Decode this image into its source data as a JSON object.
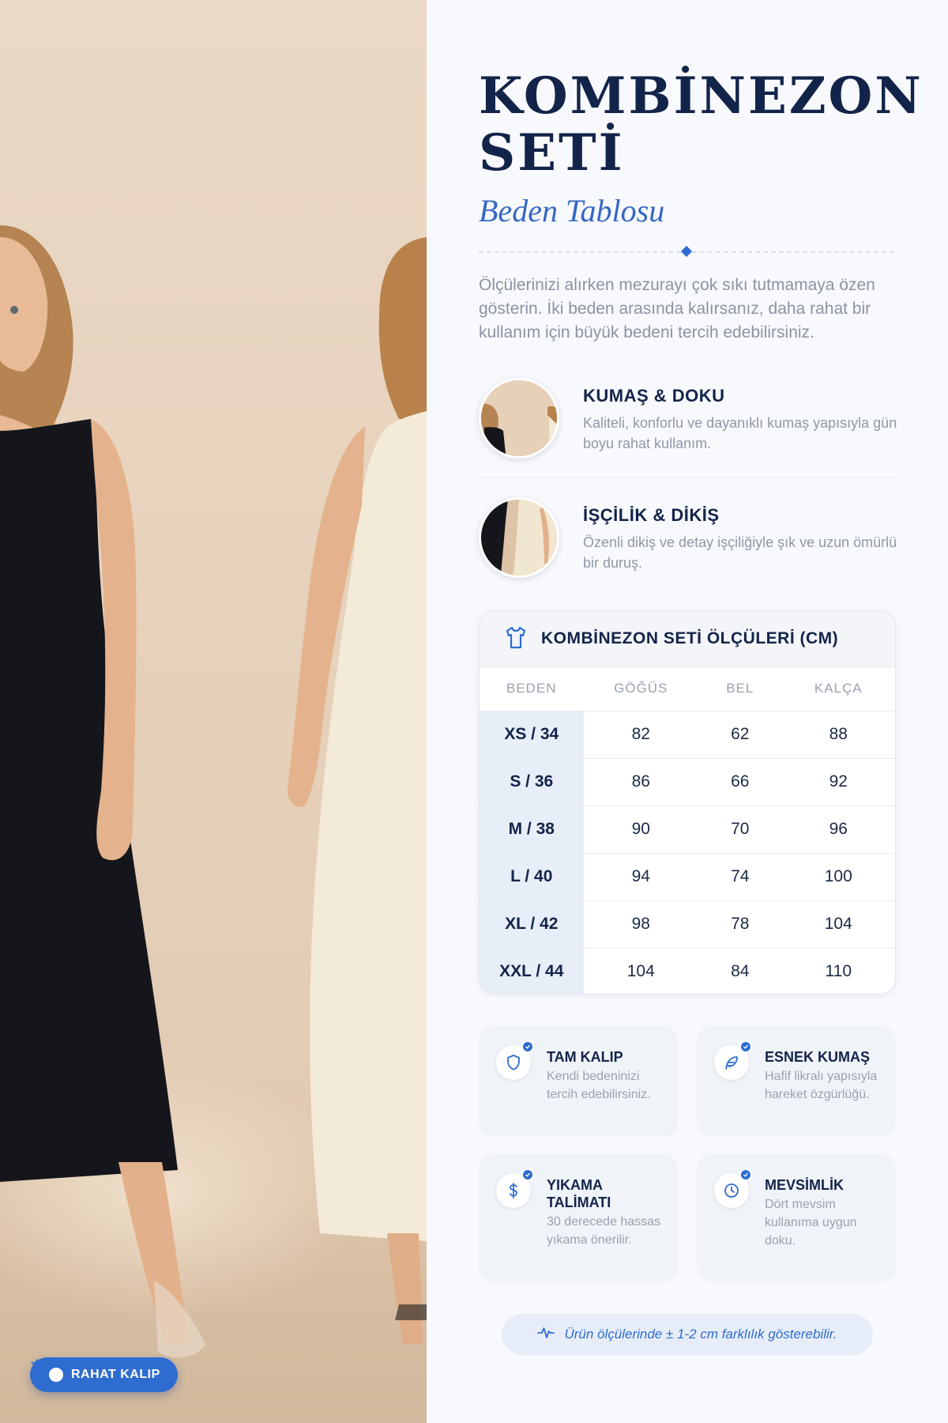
{
  "product": {
    "title": "KOMBİNEZON SETİ",
    "subtitle": "Beden Tablosu",
    "intro": "Ölçülerinizi alırken mezurayı çok sıkı tutmamaya özen gösterin. İki beden arasında kalırsanız, daha rahat bir kullanım için büyük bedeni tercih edebilirsiniz."
  },
  "badge": {
    "label": "RAHAT KALIP",
    "icon": "check-circle-icon"
  },
  "features": [
    {
      "title": "KUMAŞ & DOKU",
      "description": "Kaliteli, konforlu ve dayanıklı kumaş yapısıyla gün boyu rahat kullanım."
    },
    {
      "title": "İŞÇİLİK & DİKİŞ",
      "description": "Özenli dikiş ve detay işçiliğiyle şık ve uzun ömürlü bir duruş."
    }
  ],
  "size_table": {
    "title": "KOMBİNEZON SETİ ÖLÇÜLERİ (CM)",
    "icon": "tshirt-icon",
    "headers": [
      "BEDEN",
      "GÖĞÜS",
      "BEL",
      "KALÇA"
    ],
    "rows": [
      [
        "XS / 34",
        "82",
        "62",
        "88"
      ],
      [
        "S / 36",
        "86",
        "66",
        "92"
      ],
      [
        "M / 38",
        "90",
        "70",
        "96"
      ],
      [
        "L / 40",
        "94",
        "74",
        "100"
      ],
      [
        "XL / 42",
        "98",
        "78",
        "104"
      ],
      [
        "XXL / 44",
        "104",
        "84",
        "110"
      ]
    ]
  },
  "info_cards": [
    {
      "title": "TAM KALIP",
      "description": "Kendi bedeninizi tercih edebilirsiniz.",
      "icon": "shield-icon"
    },
    {
      "title": "ESNEK KUMAŞ",
      "description": "Hafif likralı yapısıyla hareket özgürlüğü.",
      "icon": "feather-icon"
    },
    {
      "title": "YIKAMA TALİMATI",
      "description": "30 derecede hassas yıkama önerilir.",
      "icon": "dollar-icon"
    },
    {
      "title": "MEVSİMLİK",
      "description": "Dört mevsim kullanıma uygun doku.",
      "icon": "clock-icon"
    }
  ],
  "note": {
    "text": "Ürün ölçülerinde ± 1-2 cm farklılık gösterebilir.",
    "icon": "activity-icon"
  },
  "colors": {
    "accent": "#2f6ccf",
    "navy": "#13244a",
    "muted": "#9aa1af"
  }
}
